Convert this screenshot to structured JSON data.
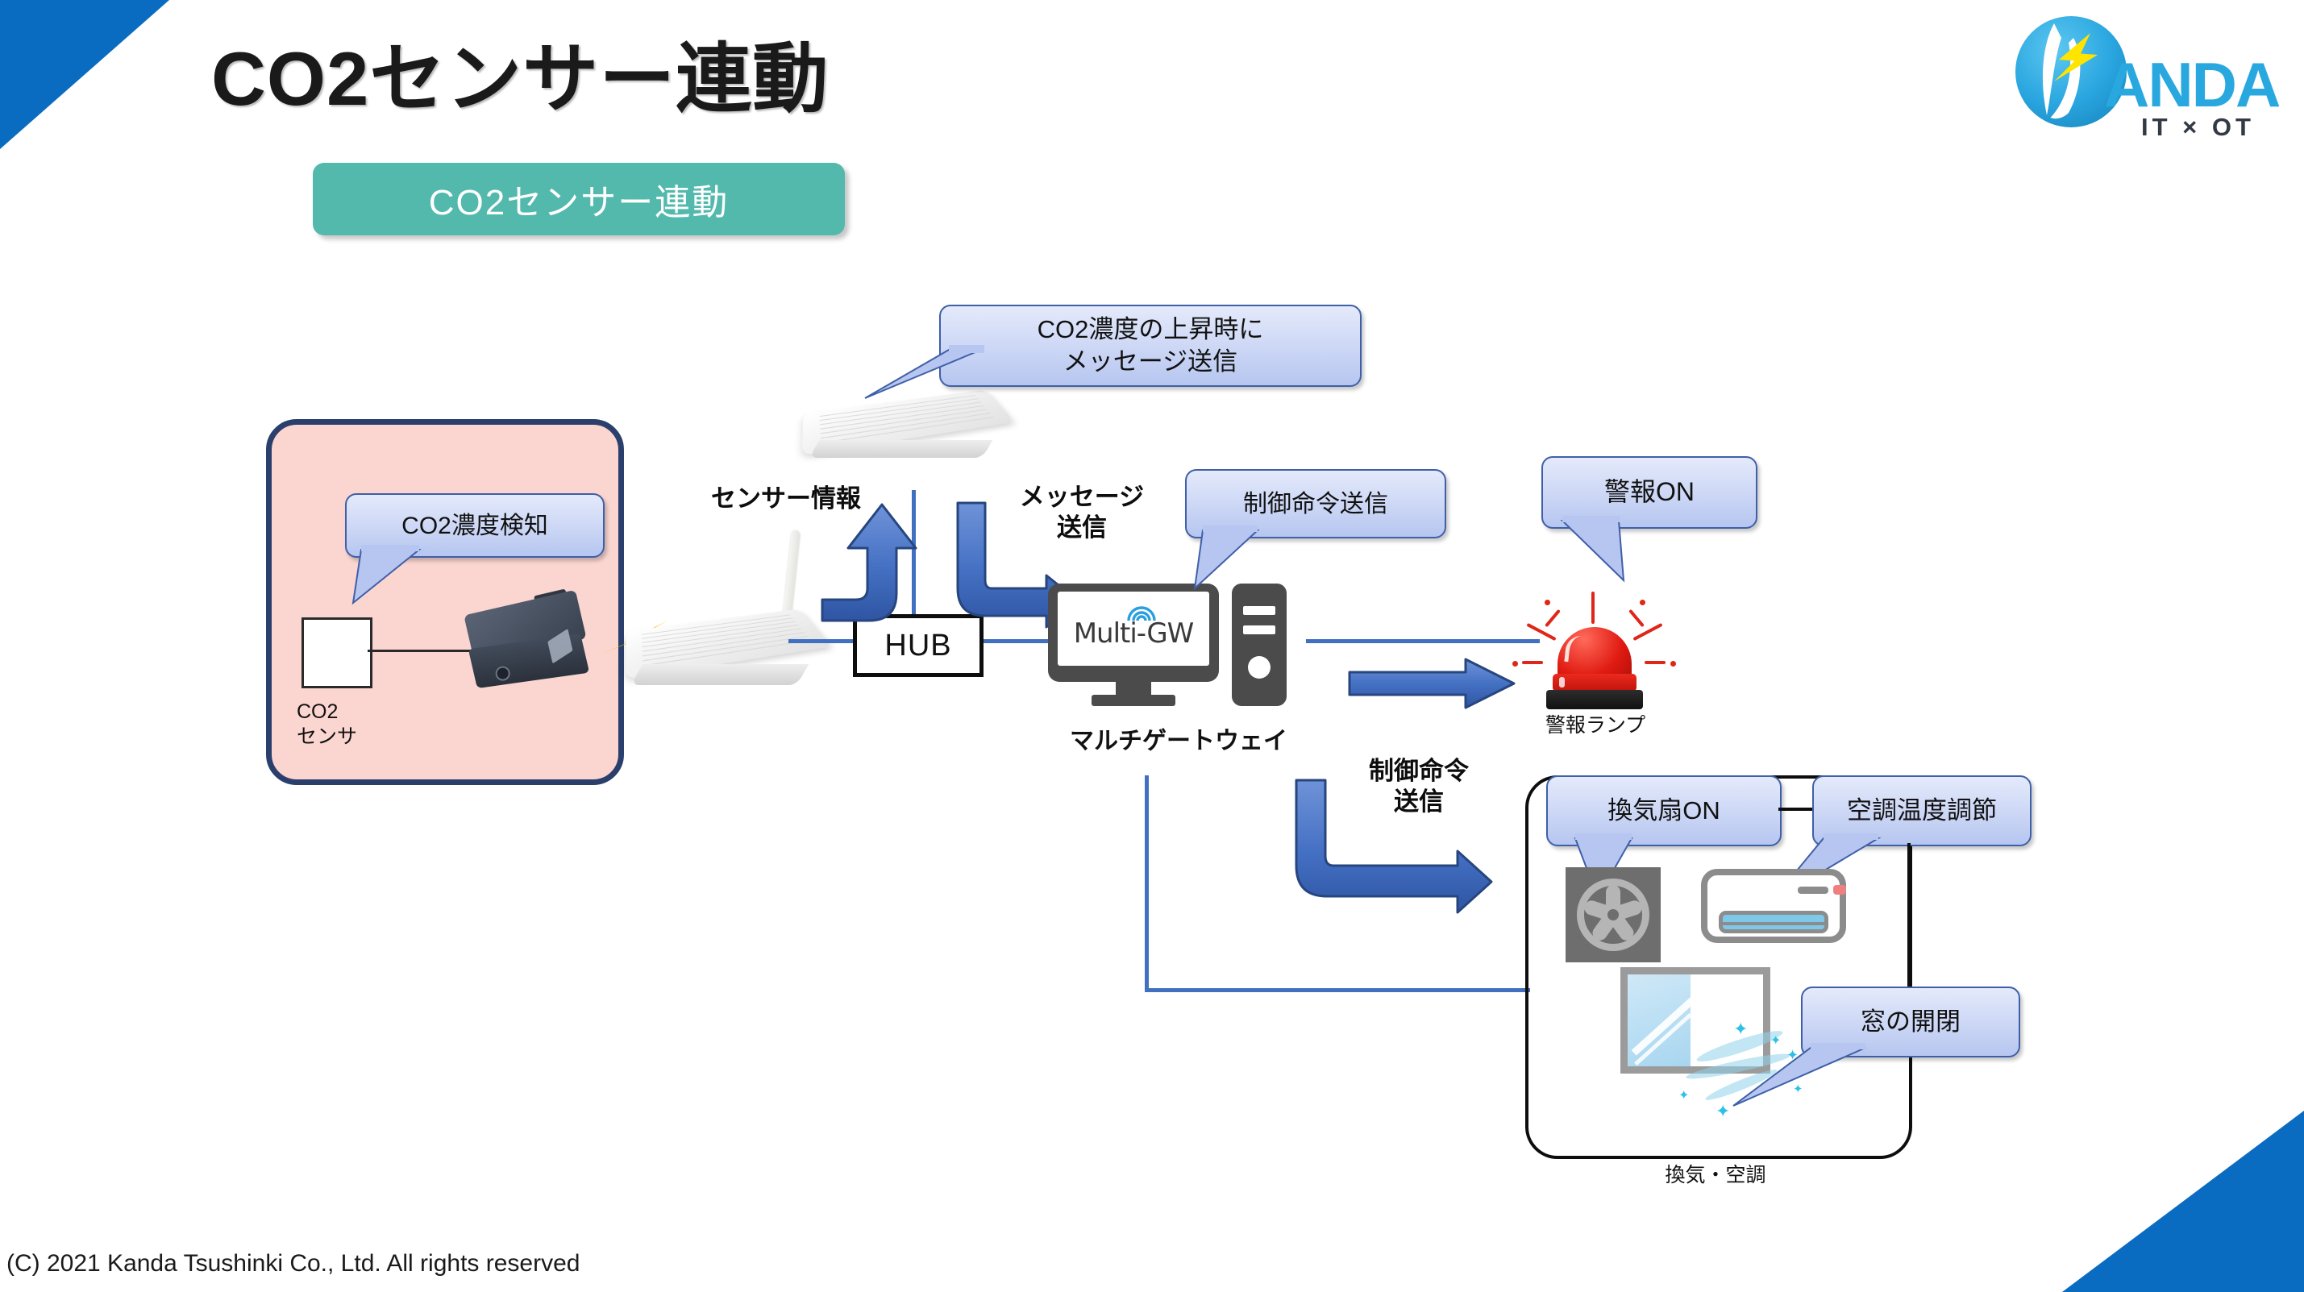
{
  "slide": {
    "title": "CO2センサー連動",
    "subtitle_pill": "CO2センサー連動",
    "footer": "(C) 2021 Kanda Tsushinki Co., Ltd. All rights reserved",
    "accent_blue": "#0a6cc1",
    "pill_teal": "#52b9ac",
    "bubble_blue": "#b6c6f0",
    "bubble_border": "#3f5fa8",
    "arrow_blue": "#4472c4",
    "pink_fill": "#fbd5d0",
    "pink_border": "#2b3f6c",
    "alarm_red": "#e01b12"
  },
  "logo": {
    "brand": "ANDA",
    "tagline": "IT × OT"
  },
  "sensor_group": {
    "bubble": "CO2濃度検知",
    "caption_line1": "CO2",
    "caption_line2": "センサ"
  },
  "network": {
    "hub_label": "HUB",
    "router_top_bubble_line1": "CO2濃度の上昇時に",
    "router_top_bubble_line2": "メッセージ送信",
    "sensor_info_label": "センサー情報",
    "message_send_label_line1": "メッセージ",
    "message_send_label_line2": "送信",
    "control_send_label_line1": "制御命令",
    "control_send_label_line2": "送信"
  },
  "gateway": {
    "screen_logo": "Multi-GW",
    "caption": "マルチゲートウェイ",
    "bubble": "制御命令送信"
  },
  "alarm": {
    "bubble": "警報ON",
    "caption": "警報ランプ"
  },
  "ventilation": {
    "caption": "換気・空調",
    "fan_bubble": "換気扇ON",
    "aircon_bubble": "空調温度調節",
    "window_bubble": "窓の開閉"
  }
}
